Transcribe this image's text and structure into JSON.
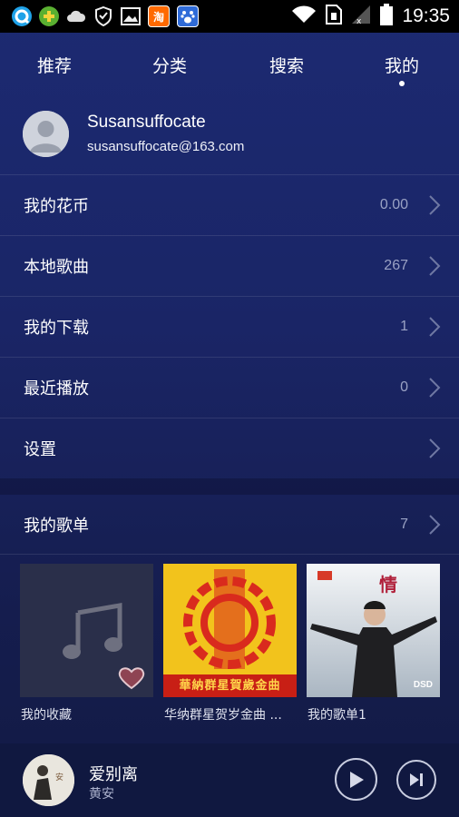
{
  "status_bar": {
    "time": "19:35",
    "taobao_label": "淘",
    "du_label": "du"
  },
  "tabs": [
    {
      "label": "推荐"
    },
    {
      "label": "分类"
    },
    {
      "label": "搜索"
    },
    {
      "label": "我的",
      "active": true
    }
  ],
  "profile": {
    "username": "Susansuffocate",
    "email": "susansuffocate@163.com"
  },
  "menu": [
    {
      "label": "我的花币",
      "value": "0.00"
    },
    {
      "label": "本地歌曲",
      "value": "267"
    },
    {
      "label": "我的下载",
      "value": "1"
    },
    {
      "label": "最近播放",
      "value": "0"
    },
    {
      "label": "设置",
      "value": ""
    }
  ],
  "playlist_section": {
    "label": "我的歌单",
    "count": "7"
  },
  "playlists": [
    {
      "title": "我的收藏"
    },
    {
      "title": "华纳群星贺岁金曲 ...",
      "cover_text": "華納群星賀歲金曲"
    },
    {
      "title": "我的歌单1",
      "cover_text": "DSD"
    }
  ],
  "now_playing": {
    "title": "爱别离",
    "artist": "黄安"
  },
  "colors": {
    "background_top": "#1c2a72",
    "background_bottom": "#121a44",
    "secondary_text": "#9aa2c4",
    "heart": "#8e4453"
  }
}
